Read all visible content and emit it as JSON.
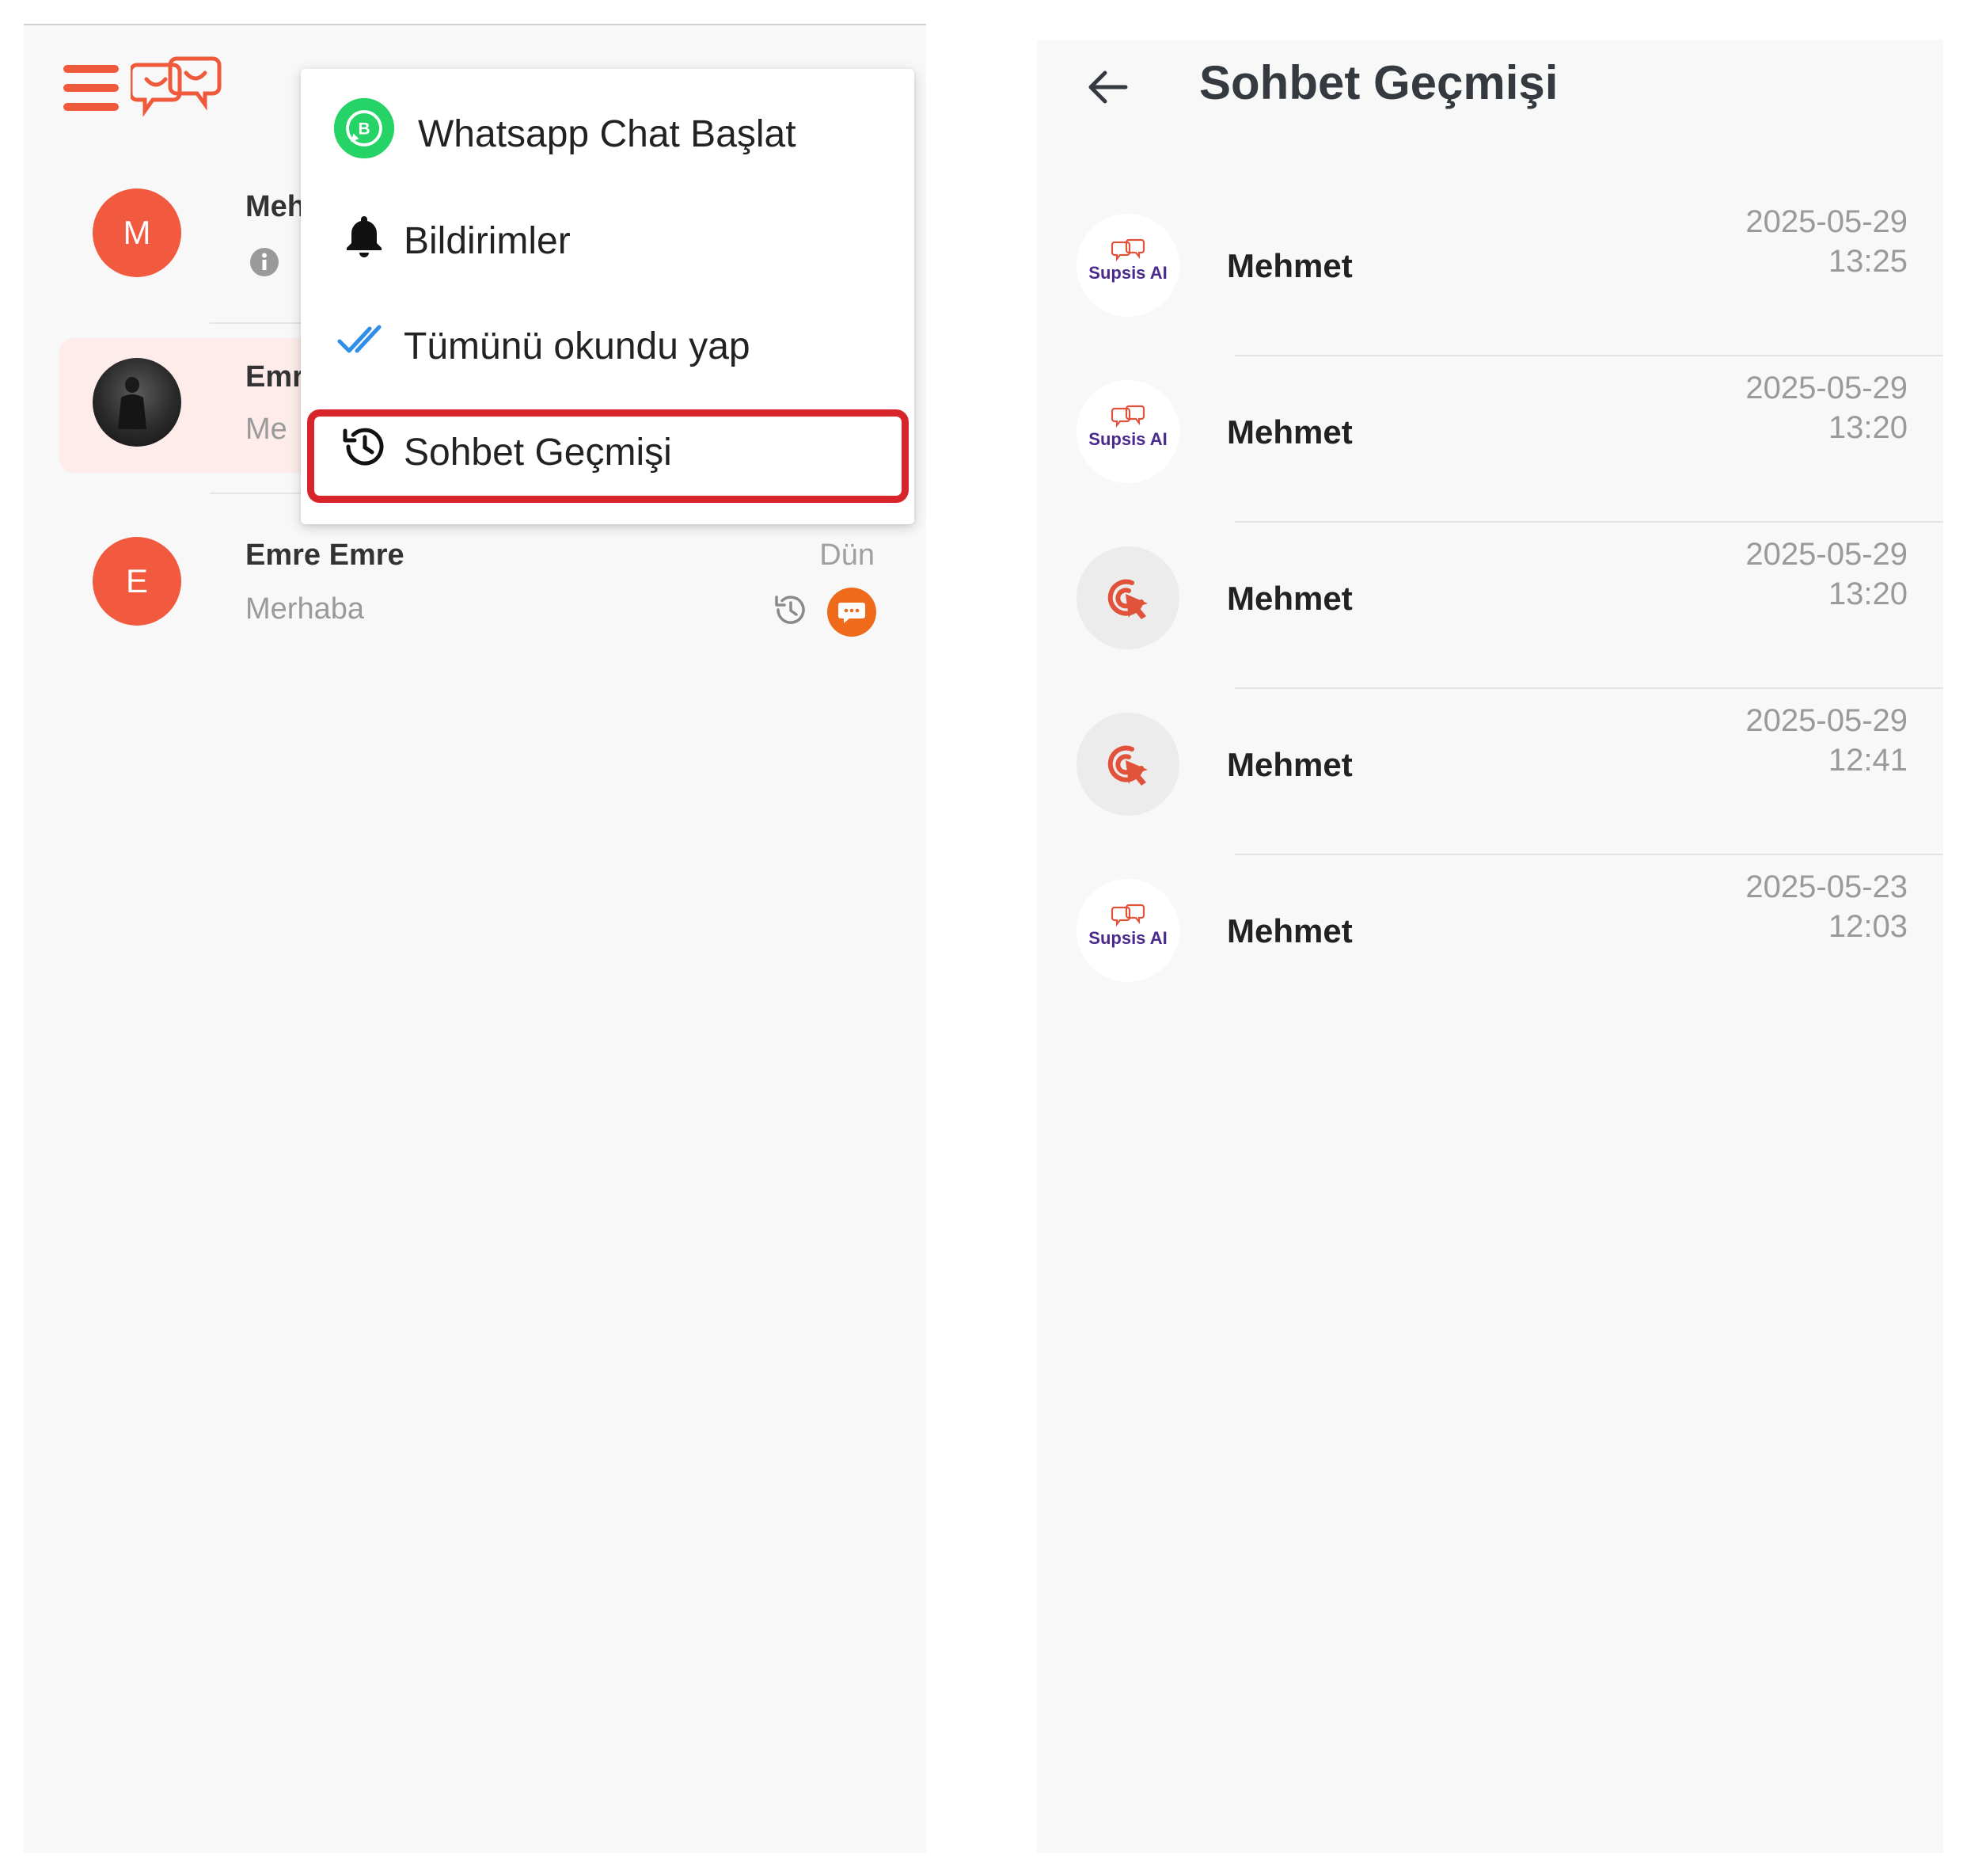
{
  "left": {
    "chats": [
      {
        "avatar_letter": "M",
        "name": "Meh",
        "preview": "",
        "time": ""
      },
      {
        "avatar_letter": "",
        "name": "Emr",
        "preview": "Me",
        "time": ""
      },
      {
        "avatar_letter": "E",
        "name": "Emre Emre",
        "preview": "Merhaba",
        "time": "Dün"
      }
    ],
    "menu": {
      "items": [
        {
          "label": "Whatsapp Chat Başlat",
          "icon": "whatsapp-business-icon"
        },
        {
          "label": "Bildirimler",
          "icon": "bell-icon"
        },
        {
          "label": "Tümünü okundu yap",
          "icon": "double-check-icon"
        },
        {
          "label": "Sohbet Geçmişi",
          "icon": "history-icon"
        }
      ]
    }
  },
  "right": {
    "title": "Sohbet Geçmişi",
    "history": [
      {
        "name": "Mehmet",
        "date": "2025-05-29",
        "time": "13:25",
        "avatar": "Supsis AI"
      },
      {
        "name": "Mehmet",
        "date": "2025-05-29",
        "time": "13:20",
        "avatar": "Supsis AI"
      },
      {
        "name": "Mehmet",
        "date": "2025-05-29",
        "time": "13:20",
        "avatar": "cursor-click-icon"
      },
      {
        "name": "Mehmet",
        "date": "2025-05-29",
        "time": "12:41",
        "avatar": "cursor-click-icon"
      },
      {
        "name": "Mehmet",
        "date": "2025-05-23",
        "time": "12:03",
        "avatar": "Supsis AI"
      }
    ]
  },
  "colors": {
    "accent": "#ef5a3c",
    "highlight": "#d8252b",
    "whatsapp": "#25d366",
    "check": "#2f8fe8"
  }
}
